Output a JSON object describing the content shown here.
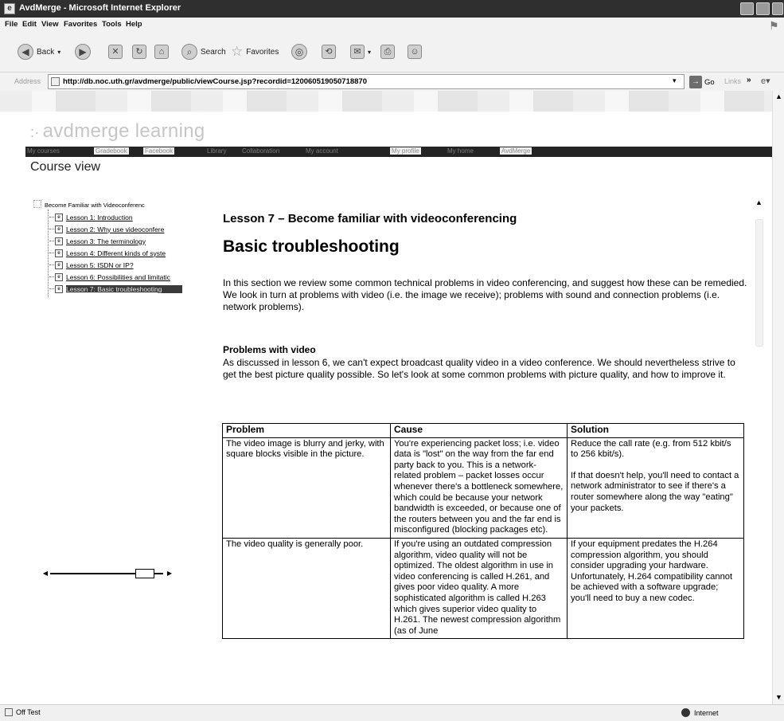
{
  "window": {
    "title": "AvdMerge - Microsoft Internet Explorer"
  },
  "menu": [
    "File",
    "Edit",
    "View",
    "Favorites",
    "Tools",
    "Help"
  ],
  "toolbar": {
    "back": "Back",
    "search": "Search",
    "favorites": "Favorites"
  },
  "address": {
    "label": "Address",
    "url": "http://db.noc.uth.gr/avdmerge/public/viewCourse.jsp?recordid=120060519050718870",
    "go": "Go",
    "links": "Links"
  },
  "site": {
    "logo": "avdmerge learning",
    "nav": [
      "My courses",
      "Gradebook",
      "Facebook",
      "Library",
      "Collaboration",
      "My account",
      "My profile",
      "My home",
      "AvdMerge"
    ],
    "heading": "Course view"
  },
  "tree": {
    "root": "Become Familiar with Videoconferenc",
    "lessons": [
      "Lesson 1: Introduction",
      "Lesson 2: Why use videoconfere",
      "Lesson 3: The terminology",
      "Lesson 4: Different kinds of syste",
      "Lesson 5: ISDN or IP?",
      "Lesson 6: Possibilities and limitatic",
      "Lesson 7: Basic troubleshooting"
    ],
    "selected_index": 6
  },
  "content": {
    "lesson_title": "Lesson 7 – Become familiar with videoconferencing",
    "section_title": "Basic troubleshooting",
    "intro": "In this section we review some common technical problems in video conferencing, and suggest how these can be remedied. We look in turn at problems with video (i.e. the image we receive); problems with sound and connection problems (i.e. network problems).",
    "video_heading": "Problems with video",
    "video_body": "As discussed in lesson 6, we can't expect broadcast quality video in a video conference. We should nevertheless strive to get the best picture quality possible. So let's look at some common problems with picture quality, and how to improve it.",
    "table": {
      "headers": [
        "Problem",
        "Cause",
        "Solution"
      ],
      "rows": [
        {
          "problem": "The video image is blurry and jerky, with square blocks visible in the picture.",
          "cause": "You're experiencing packet loss; i.e. video data is \"lost\" on the way from the far end party back to you. This is a network-related problem – packet losses occur whenever there's a bottleneck somewhere, which could be because your network bandwidth is exceeded, or because one of the routers between you and the far end is misconfigured (blocking packages etc).",
          "solution_1": "Reduce the call rate (e.g. from 512 kbit/s to 256 kbit/s).",
          "solution_2": "If that doesn't help, you'll need to contact a network administrator to see if there's a router somewhere along the way \"eating\" your packets."
        },
        {
          "problem": "The video quality is generally poor.",
          "cause": "If you're using an outdated compression algorithm, video quality will not be optimized. The oldest algorithm in use in video conferencing is called H.261, and gives poor video quality. A more sophisticated algorithm is called H.263 which gives superior video quality to H.261. The newest compression algorithm (as of June",
          "solution_1": "If your equipment predates the H.264 compression algorithm, you should consider upgrading your hardware. Unfortunately, H.264 compatibility cannot be achieved with a software upgrade; you'll need to buy a new codec.",
          "solution_2": ""
        }
      ]
    }
  },
  "status": {
    "left": "Off Test",
    "zone": "Internet"
  }
}
